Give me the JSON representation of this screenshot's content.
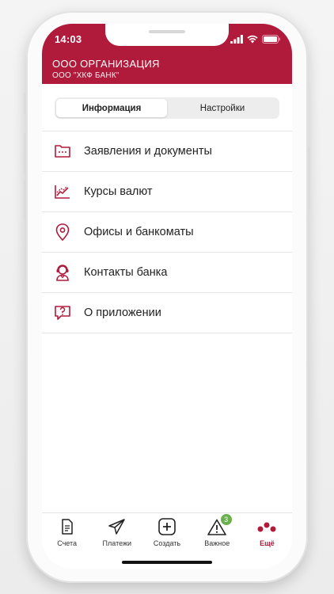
{
  "status_bar": {
    "time": "14:03"
  },
  "header": {
    "org_name": "ООО ОРГАНИЗАЦИЯ",
    "bank_name": "ООО \"ХКФ БАНК\""
  },
  "segments": [
    {
      "label": "Информация",
      "active": true
    },
    {
      "label": "Настройки",
      "active": false
    }
  ],
  "menu": [
    {
      "label": "Заявления и документы",
      "icon": "documents-folder-icon"
    },
    {
      "label": "Курсы валют",
      "icon": "currency-chart-icon"
    },
    {
      "label": "Офисы и банкоматы",
      "icon": "location-pin-icon"
    },
    {
      "label": "Контакты банка",
      "icon": "support-operator-icon"
    },
    {
      "label": "О приложении",
      "icon": "question-bubble-icon"
    }
  ],
  "tabbar": [
    {
      "label": "Счета",
      "icon": "document-icon"
    },
    {
      "label": "Платежи",
      "icon": "paper-plane-icon"
    },
    {
      "label": "Создать",
      "icon": "plus-square-icon"
    },
    {
      "label": "Важное",
      "icon": "warning-triangle-icon",
      "badge": "3"
    },
    {
      "label": "Ещё",
      "icon": "more-dots-icon",
      "active": true
    }
  ],
  "colors": {
    "brand": "#b01a3b",
    "badge": "#6ab04c"
  }
}
